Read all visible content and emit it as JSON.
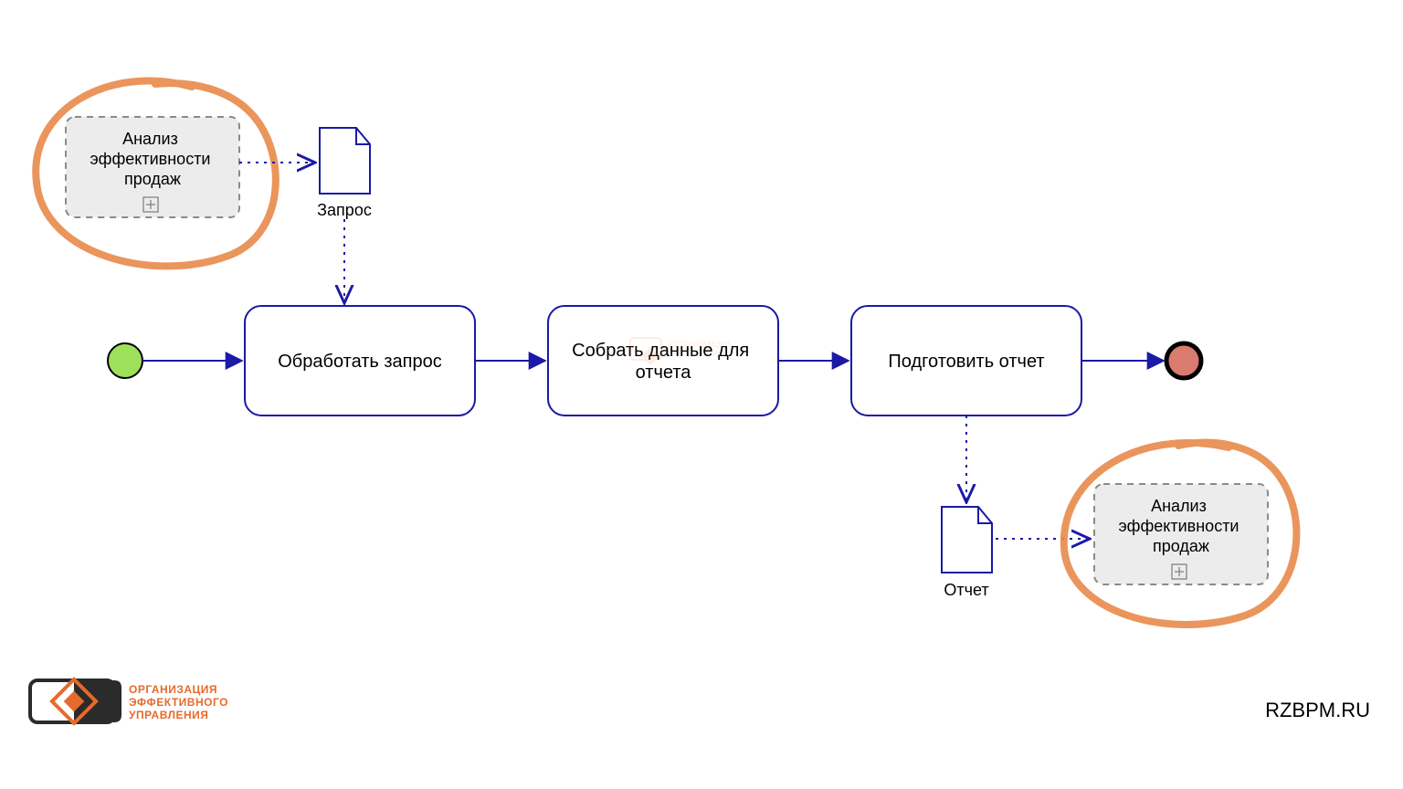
{
  "tasks": {
    "t1": "Обработать запрос",
    "t2_line1": "Собрать данные для",
    "t2_line2": "отчета",
    "t3": "Подготовить отчет"
  },
  "subprocesses": {
    "sp1_line1": "Анализ",
    "sp1_line2": "эффективности",
    "sp1_line3": "продаж",
    "sp2_line1": "Анализ",
    "sp2_line2": "эффективности",
    "sp2_line3": "продаж"
  },
  "dataObjects": {
    "d1": "Запрос",
    "d2": "Отчет"
  },
  "logo": {
    "line1": "ОРГАНИЗАЦИЯ",
    "line2": "ЭФФЕКТИВНОГО",
    "line3": "УПРАВЛЕНИЯ"
  },
  "site": "RZBPM.RU",
  "colors": {
    "flow": "#1a1aa6",
    "dashed": "#1a1aa6",
    "taskStroke": "#1a1aa6",
    "subFill": "#ececec",
    "subStroke": "#8a8a8a",
    "startFill": "#9fe05a",
    "endFill": "#d97b6e",
    "circleStroke": "#000",
    "highlight": "#e88a4a"
  }
}
